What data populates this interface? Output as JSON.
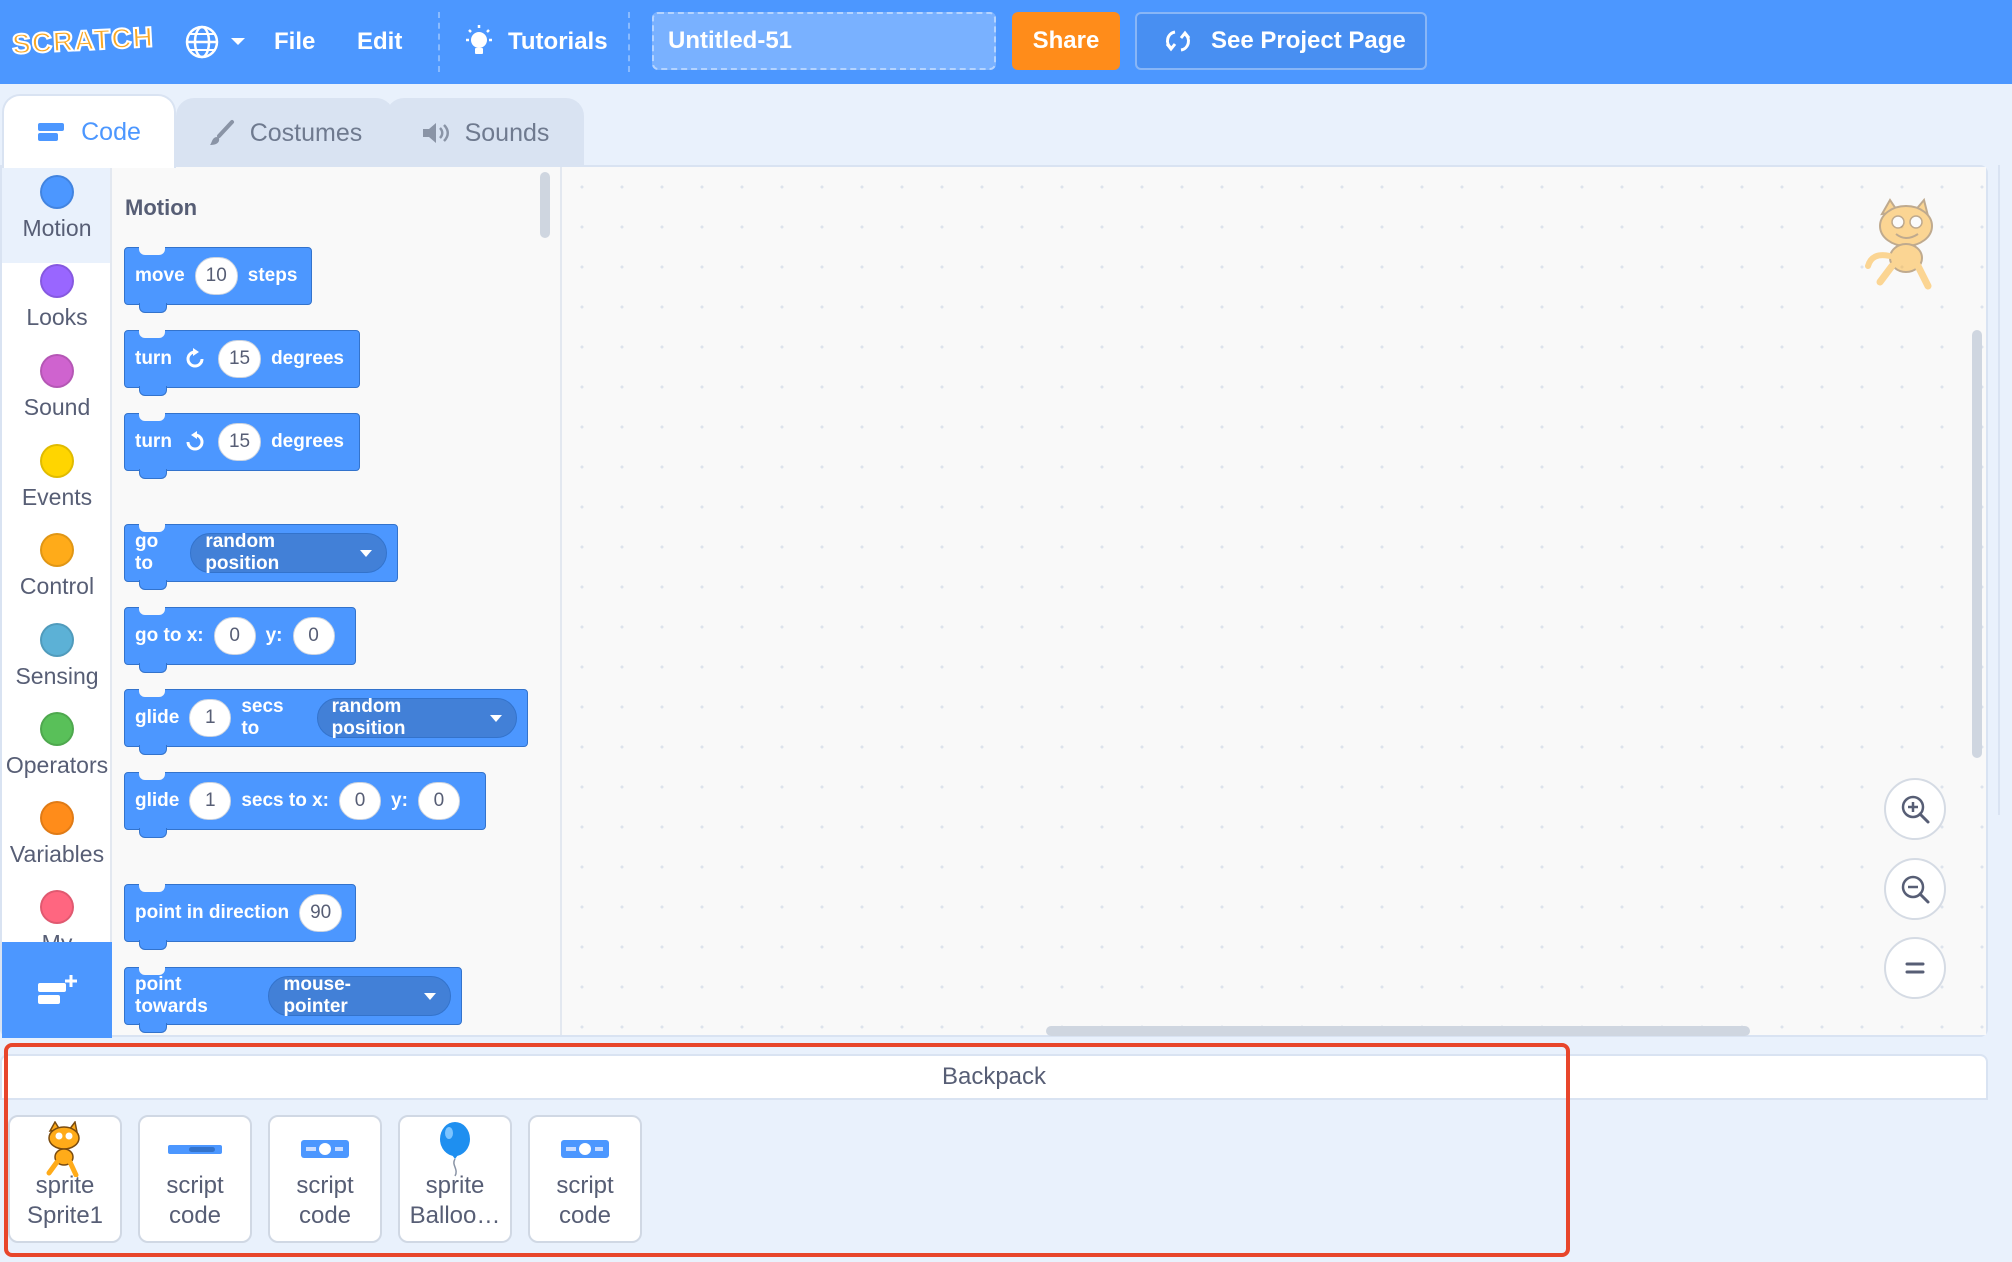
{
  "menubar": {
    "logo_text": "SCRATCH",
    "file_label": "File",
    "edit_label": "Edit",
    "tutorials_label": "Tutorials",
    "project_title": "Untitled-51",
    "share_label": "Share",
    "see_project_page_label": "See Project Page",
    "bg_color": "#4c97ff",
    "share_color": "#ff8c1a"
  },
  "tabs": [
    {
      "label": "Code",
      "icon": "code-icon",
      "active": true
    },
    {
      "label": "Costumes",
      "icon": "brush-icon",
      "active": false
    },
    {
      "label": "Sounds",
      "icon": "speaker-icon",
      "active": false
    }
  ],
  "categories": [
    {
      "label": "Motion",
      "color": "#4c97ff"
    },
    {
      "label": "Looks",
      "color": "#9966ff"
    },
    {
      "label": "Sound",
      "color": "#cf63cf"
    },
    {
      "label": "Events",
      "color": "#ffd500"
    },
    {
      "label": "Control",
      "color": "#ffab19"
    },
    {
      "label": "Sensing",
      "color": "#5cb1d6"
    },
    {
      "label": "Operators",
      "color": "#59c059"
    },
    {
      "label": "Variables",
      "color": "#ff8c1a"
    },
    {
      "label": "My",
      "color": "#ff6680"
    }
  ],
  "palette": {
    "heading": "Motion",
    "blocks": {
      "move": {
        "t1": "move",
        "n1": "10",
        "t2": "steps"
      },
      "turn_right": {
        "t1": "turn",
        "n1": "15",
        "t2": "degrees"
      },
      "turn_left": {
        "t1": "turn",
        "n1": "15",
        "t2": "degrees"
      },
      "goto": {
        "t1": "go to",
        "d1": "random position"
      },
      "goto_xy": {
        "t1": "go to x:",
        "n1": "0",
        "t2": "y:",
        "n2": "0"
      },
      "glide": {
        "t1": "glide",
        "n1": "1",
        "t2": "secs to",
        "d1": "random position"
      },
      "glide_xy": {
        "t1": "glide",
        "n1": "1",
        "t2": "secs to x:",
        "n2": "0",
        "t3": "y:",
        "n3": "0"
      },
      "point_dir": {
        "t1": "point in direction",
        "n1": "90"
      },
      "point_towards": {
        "t1": "point towards",
        "d1": "mouse-pointer"
      }
    }
  },
  "backpack": {
    "title": "Backpack",
    "items": [
      {
        "type": "sprite",
        "name": "Sprite1"
      },
      {
        "type": "script",
        "name": "code"
      },
      {
        "type": "script",
        "name": "code"
      },
      {
        "type": "sprite",
        "name": "Balloo…"
      },
      {
        "type": "script",
        "name": "code"
      }
    ],
    "highlight_color": "#e8462b"
  }
}
